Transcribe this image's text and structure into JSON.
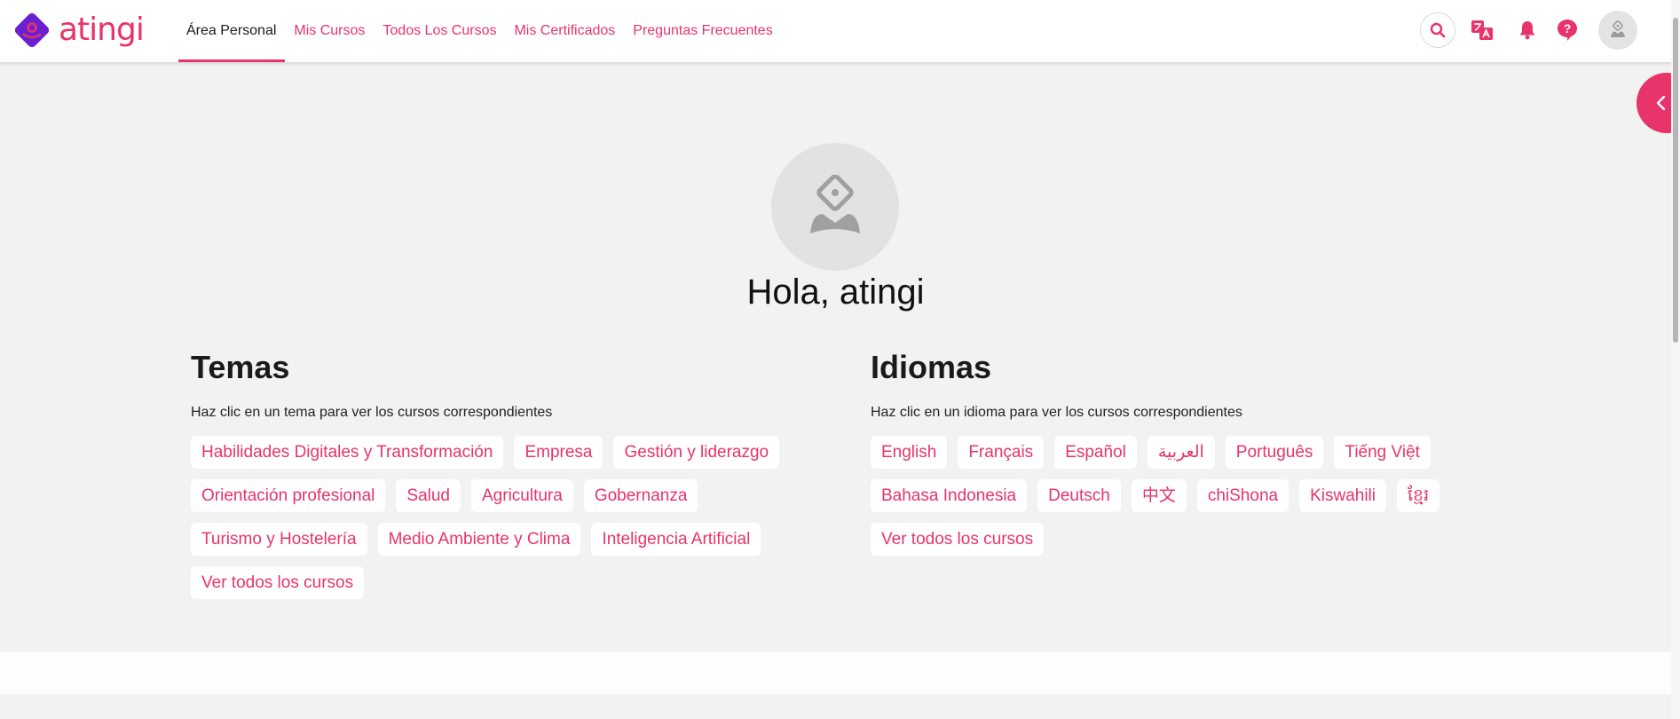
{
  "brand": {
    "name": "atingi",
    "color": "#e8336b",
    "logo_color": "#6a1fd1"
  },
  "nav": {
    "items": [
      {
        "label": "Área Personal",
        "active": true
      },
      {
        "label": "Mis Cursos",
        "active": false
      },
      {
        "label": "Todos Los Cursos",
        "active": false
      },
      {
        "label": "Mis Certificados",
        "active": false
      },
      {
        "label": "Preguntas Frecuentes",
        "active": false
      }
    ]
  },
  "header_icons": [
    "search-icon",
    "translate-icon",
    "bell-icon",
    "help-icon",
    "user-avatar-icon"
  ],
  "profile": {
    "greeting": "Hola, atingi"
  },
  "topics": {
    "title": "Temas",
    "subtitle": "Haz clic en un tema para ver los cursos correspondientes",
    "items": [
      "Habilidades Digitales y Transformación",
      "Empresa",
      "Gestión y liderazgo",
      "Orientación profesional",
      "Salud",
      "Agricultura",
      "Gobernanza",
      "Turismo y Hostelería",
      "Medio Ambiente y Clima",
      "Inteligencia Artificial",
      "Ver todos los cursos"
    ]
  },
  "languages": {
    "title": "Idiomas",
    "subtitle": "Haz clic en un idioma para ver los cursos correspondientes",
    "items": [
      "English",
      "Français",
      "Español",
      "العربية",
      "Português",
      "Tiếng Việt",
      "Bahasa Indonesia",
      "Deutsch",
      "中文",
      "chiShona",
      "Kiswahili",
      "ខ្មែរ",
      "Ver todos los cursos"
    ]
  }
}
